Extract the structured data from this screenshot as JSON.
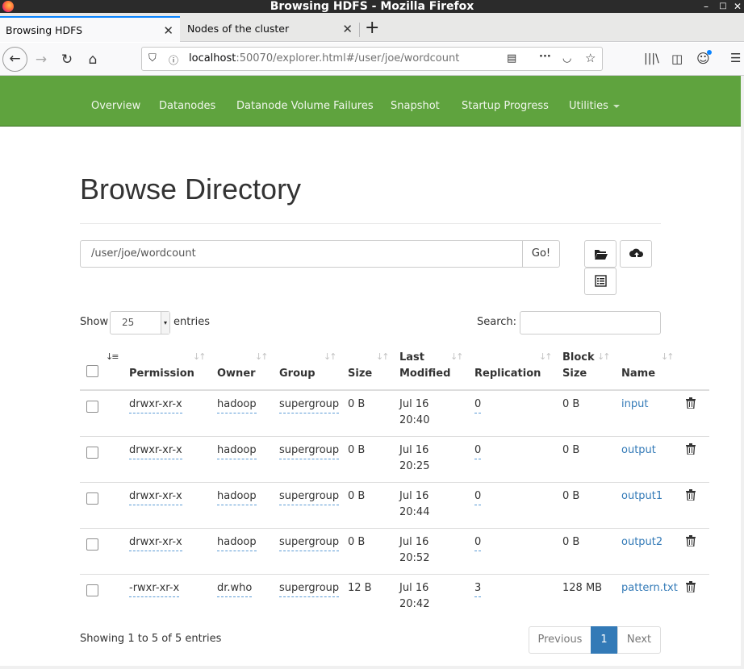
{
  "window": {
    "title": "Browsing HDFS - Mozilla Firefox"
  },
  "tabs": [
    {
      "label": "Browsing HDFS"
    },
    {
      "label": "Nodes of the cluster"
    }
  ],
  "urlbar": {
    "host": "localhost",
    "rest": ":50070/explorer.html#/user/joe/wordcount"
  },
  "topnav": {
    "items": [
      "Overview",
      "Datanodes",
      "Datanode Volume Failures",
      "Snapshot",
      "Startup Progress",
      "Utilities"
    ]
  },
  "page": {
    "title": "Browse Directory",
    "path_value": "/user/joe/wordcount",
    "go_label": "Go!",
    "show_label": "Show",
    "entries_value": "25",
    "entries_label": "entries",
    "search_label": "Search:"
  },
  "table": {
    "headers": {
      "permission": "Permission",
      "owner": "Owner",
      "group": "Group",
      "size": "Size",
      "last_modified_1": "Last",
      "last_modified_2": "Modified",
      "replication": "Replication",
      "block_size_1": "Block",
      "block_size_2": "Size",
      "name": "Name"
    },
    "rows": [
      {
        "permission": "drwxr-xr-x",
        "owner": "hadoop",
        "group": "supergroup",
        "size": "0 B",
        "date": "Jul 16",
        "time": "20:40",
        "replication": "0",
        "block_size": "0 B",
        "name": "input"
      },
      {
        "permission": "drwxr-xr-x",
        "owner": "hadoop",
        "group": "supergroup",
        "size": "0 B",
        "date": "Jul 16",
        "time": "20:25",
        "replication": "0",
        "block_size": "0 B",
        "name": "output"
      },
      {
        "permission": "drwxr-xr-x",
        "owner": "hadoop",
        "group": "supergroup",
        "size": "0 B",
        "date": "Jul 16",
        "time": "20:44",
        "replication": "0",
        "block_size": "0 B",
        "name": "output1"
      },
      {
        "permission": "drwxr-xr-x",
        "owner": "hadoop",
        "group": "supergroup",
        "size": "0 B",
        "date": "Jul 16",
        "time": "20:52",
        "replication": "0",
        "block_size": "0 B",
        "name": "output2"
      },
      {
        "permission": "-rwxr-xr-x",
        "owner": "dr.who",
        "group": "supergroup",
        "size": "12 B",
        "date": "Jul 16",
        "time": "20:42",
        "replication": "3",
        "block_size": "128 MB",
        "name": "pattern.txt"
      }
    ]
  },
  "footer": {
    "info": "Showing 1 to 5 of 5 entries",
    "previous": "Previous",
    "page": "1",
    "next": "Next"
  },
  "colors": {
    "navbar": "#5fa33e",
    "link": "#337ab7",
    "active_page": "#337ab7"
  }
}
